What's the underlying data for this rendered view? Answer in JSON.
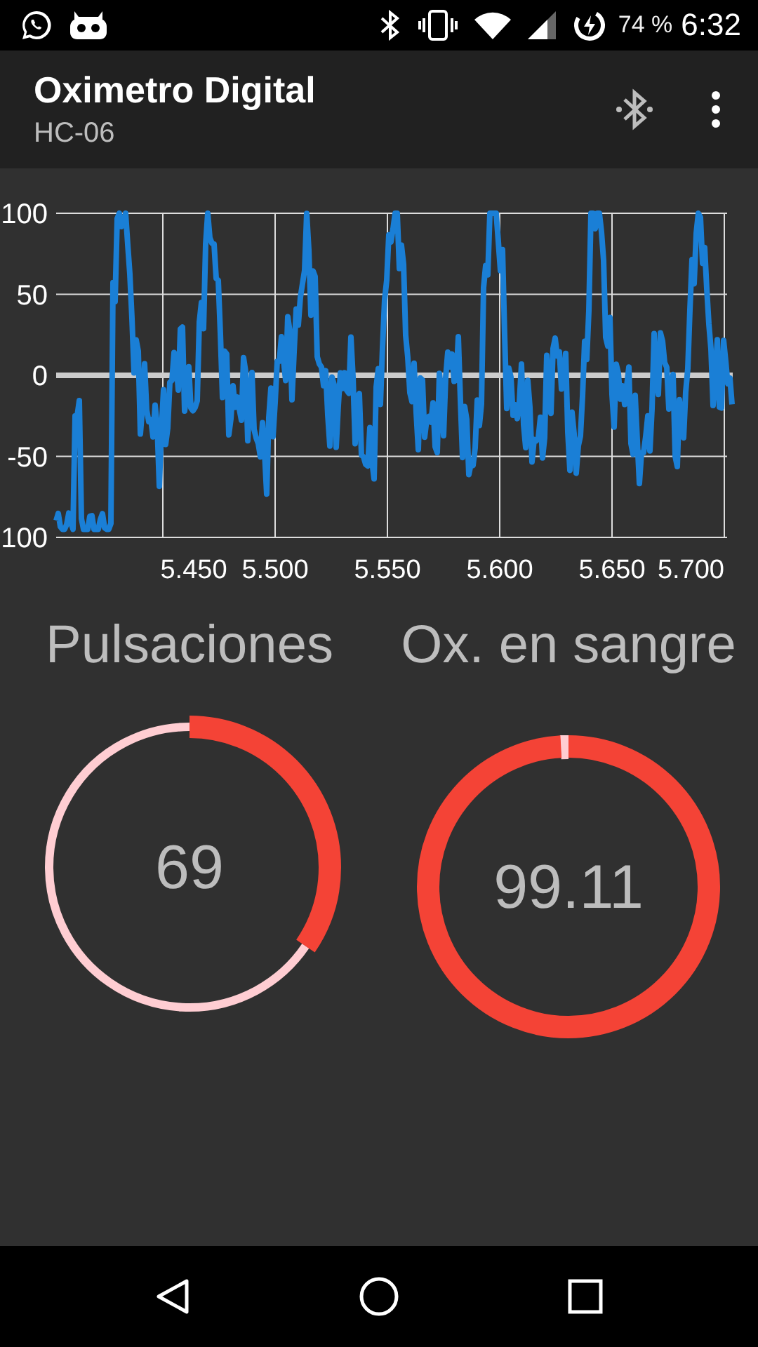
{
  "status_bar": {
    "battery": "74 %",
    "time": "6:32"
  },
  "app_bar": {
    "title": "Oximetro Digital",
    "subtitle": "HC-06"
  },
  "chart": {
    "y_labels": [
      "100",
      "50",
      "0",
      "-50",
      "100"
    ],
    "x_labels": [
      "5.450",
      "5.500",
      "5.550",
      "5.600",
      "5.650",
      "5.700"
    ]
  },
  "gauges": [
    {
      "label": "Pulsaciones",
      "value": "69",
      "level": 0.345
    },
    {
      "label": "Ox. en sangre",
      "value": "99.11",
      "level": 0.991
    }
  ]
}
